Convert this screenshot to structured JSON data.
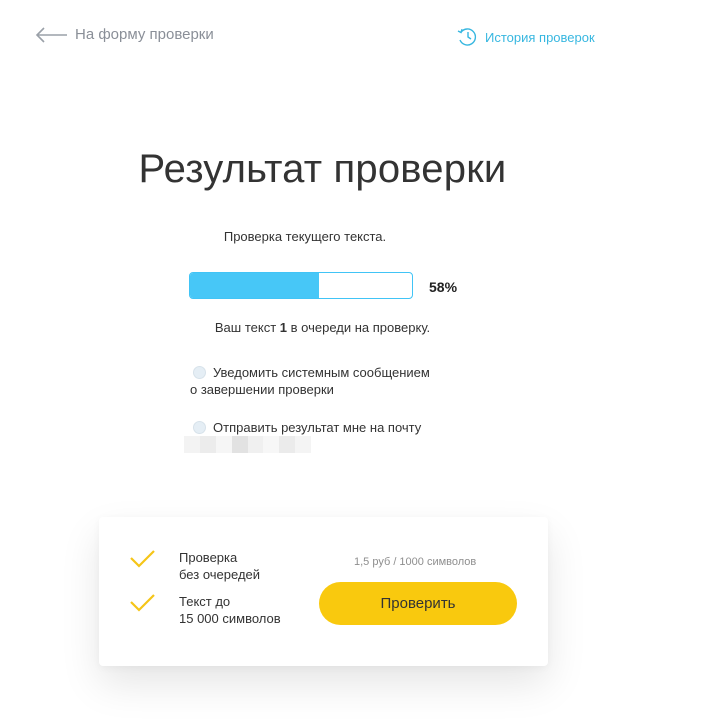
{
  "header": {
    "back_label": "На форму проверки",
    "history_label": "История проверок"
  },
  "title": "Результат проверки",
  "subtitle": "Проверка текущего текста.",
  "progress": {
    "percent": 58,
    "label": "58%"
  },
  "queue": {
    "prefix": "Ваш текст",
    "position": "1",
    "suffix": "в очереди на проверку."
  },
  "options": {
    "notify_line1": "Уведомить системным сообщением",
    "notify_line2": "о завершении проверки",
    "email_label": "Отправить результат мне на почту"
  },
  "card": {
    "feature1_line1": "Проверка",
    "feature1_line2": "без очередей",
    "feature2_line1": "Текст до",
    "feature2_line2": "15 000 символов",
    "price": "1,5 руб / 1000 символов",
    "button_label": "Проверить"
  },
  "colors": {
    "accent_blue": "#47c7f7",
    "link_blue": "#37b7e0",
    "button_yellow": "#f9c90e",
    "check_yellow": "#f5c518"
  }
}
